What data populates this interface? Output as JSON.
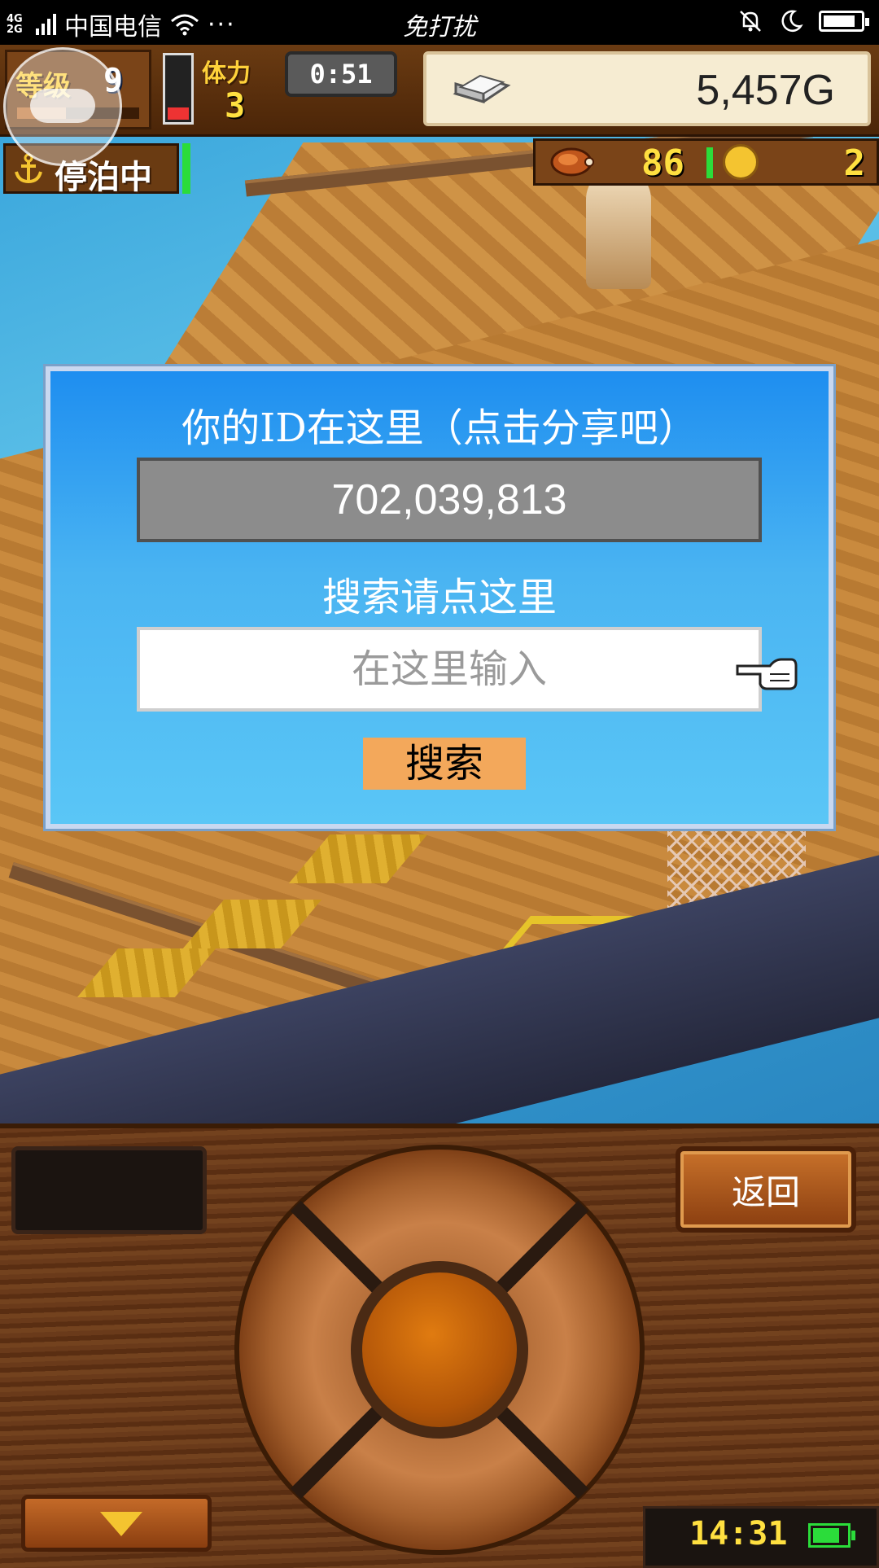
{
  "status_bar": {
    "network": "4G 2G",
    "carrier": "中国电信",
    "more": "···",
    "center_text": "免打扰"
  },
  "hud": {
    "level_label": "等级",
    "level": "9",
    "stamina_label": "体力",
    "stamina": "3",
    "timer": "0:51",
    "gold": "5,457G",
    "docked_label": "停泊中",
    "food": "86",
    "coins": "2"
  },
  "dialog": {
    "title": "你的ID在这里（点击分享吧）",
    "id_value": "702,039,813",
    "search_label": "搜索请点这里",
    "input_placeholder": "在这里输入",
    "search_button": "搜索"
  },
  "console": {
    "back_button": "返回",
    "clock": "14:31"
  }
}
